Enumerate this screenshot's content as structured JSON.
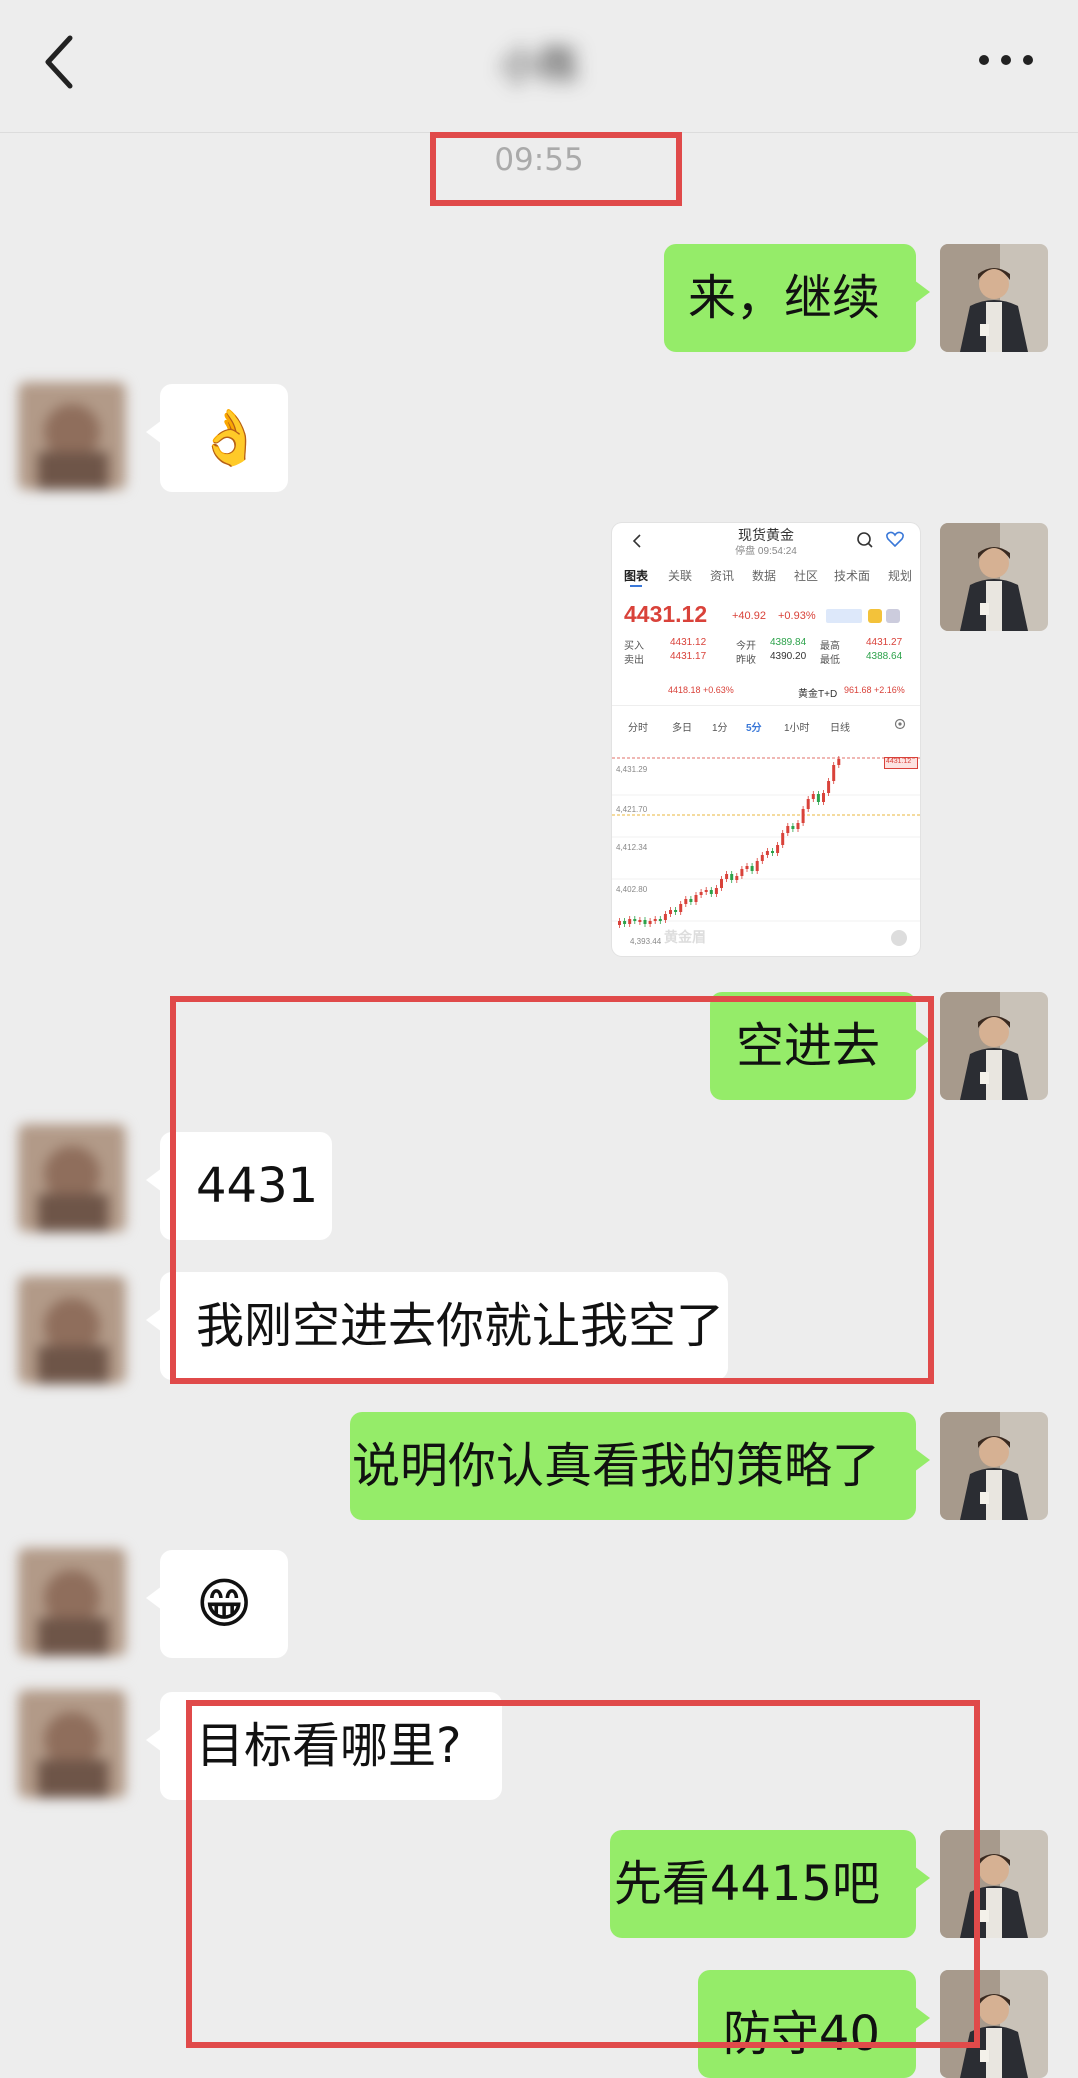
{
  "header": {
    "title": "小陈"
  },
  "timestamp": "09:55",
  "messages": {
    "m1": {
      "text": "来，继续"
    },
    "m2": {
      "text": "👌"
    },
    "m3": {
      "text": "空进去"
    },
    "m4": {
      "text": "4431"
    },
    "m5": {
      "text": "我刚空进去你就让我空了"
    },
    "m6": {
      "text": "说明你认真看我的策略了"
    },
    "m7": {
      "text": "😁"
    },
    "m8": {
      "text": "目标看哪里?"
    },
    "m9": {
      "text": "先看4415吧"
    },
    "m10": {
      "text": "防守40"
    }
  },
  "screenshot": {
    "title": "现货黄金",
    "status": "停盘 09:54:24",
    "tabs": [
      "图表",
      "关联",
      "资讯",
      "数据",
      "社区",
      "技术面",
      "规划"
    ],
    "price": "4431.12",
    "change": "+40.92",
    "change_pct": "+0.93%",
    "quotes": {
      "buy_label": "买入",
      "buy": "4431.12",
      "sell_label": "卖出",
      "sell": "4431.17",
      "open_label": "今开",
      "open": "4389.84",
      "prev_label": "昨收",
      "prev": "4390.20",
      "high_label": "最高",
      "high": "4431.27",
      "low_label": "最低",
      "low": "4388.64"
    },
    "sub_left": "4418.18 +0.63%",
    "sub_right_label": "黄金T+D",
    "sub_right": "961.68 +2.16%",
    "periods": [
      "分时",
      "多日",
      "1分",
      "5分",
      "1小时",
      "日线"
    ],
    "axis_labels": [
      "4,431.29",
      "4,421.70",
      "4,412.34",
      "4,402.80",
      "4,393.44"
    ],
    "price_tag": "4431.12",
    "watermark": "黄金眉"
  },
  "colors": {
    "green_bubble": "#95ec69",
    "white_bubble": "#ffffff",
    "bg": "#ededed",
    "annotation": "#e04a4a",
    "up": "#d9423a",
    "down": "#2ca24a"
  }
}
